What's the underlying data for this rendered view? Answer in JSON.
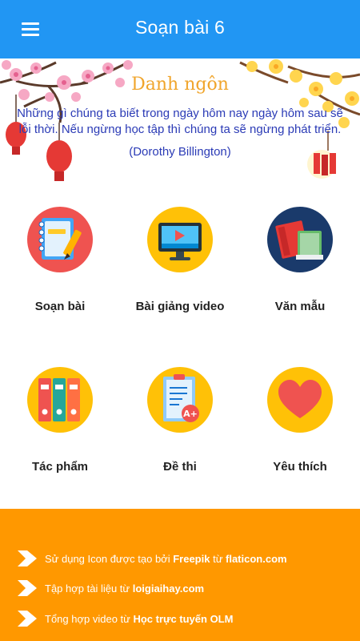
{
  "appbar": {
    "title": "Soạn bài 6",
    "menu_icon": "hamburger-menu-icon",
    "color": "#2196f3"
  },
  "banner": {
    "title": "Danh ngôn",
    "quote": "Những gì chúng ta biết trong ngày hôm nay ngày hôm sau sẽ lỗi thời. Nếu ngừng học tập thì chúng ta sẽ ngừng phát triển.",
    "author": "(Dorothy Billington)",
    "title_color": "#f0a52c",
    "text_color": "#2b3bb6"
  },
  "menu": {
    "items": [
      {
        "label": "Soạn bài",
        "icon": "notebook-pencil-icon"
      },
      {
        "label": "Bài giảng video",
        "icon": "video-monitor-icon"
      },
      {
        "label": "Văn mẫu",
        "icon": "books-stack-icon"
      },
      {
        "label": "Tác phẩm",
        "icon": "binders-icon"
      },
      {
        "label": "Đề thi",
        "icon": "exam-paper-icon"
      },
      {
        "label": "Yêu thích",
        "icon": "heart-icon"
      }
    ]
  },
  "footer": {
    "color": "#ff9800",
    "rows": [
      {
        "prefix": "Sử dụng Icon được tạo bởi ",
        "bold1": "Freepik",
        "middle": " từ ",
        "bold2": "flaticon.com"
      },
      {
        "prefix": "Tập hợp tài liệu từ ",
        "bold1": "loigiaihay.com",
        "middle": "",
        "bold2": ""
      },
      {
        "prefix": "Tổng hợp video từ ",
        "bold1": "Học trực tuyến OLM",
        "middle": "",
        "bold2": ""
      }
    ],
    "arrow_icon": "chevron-right-icon"
  }
}
